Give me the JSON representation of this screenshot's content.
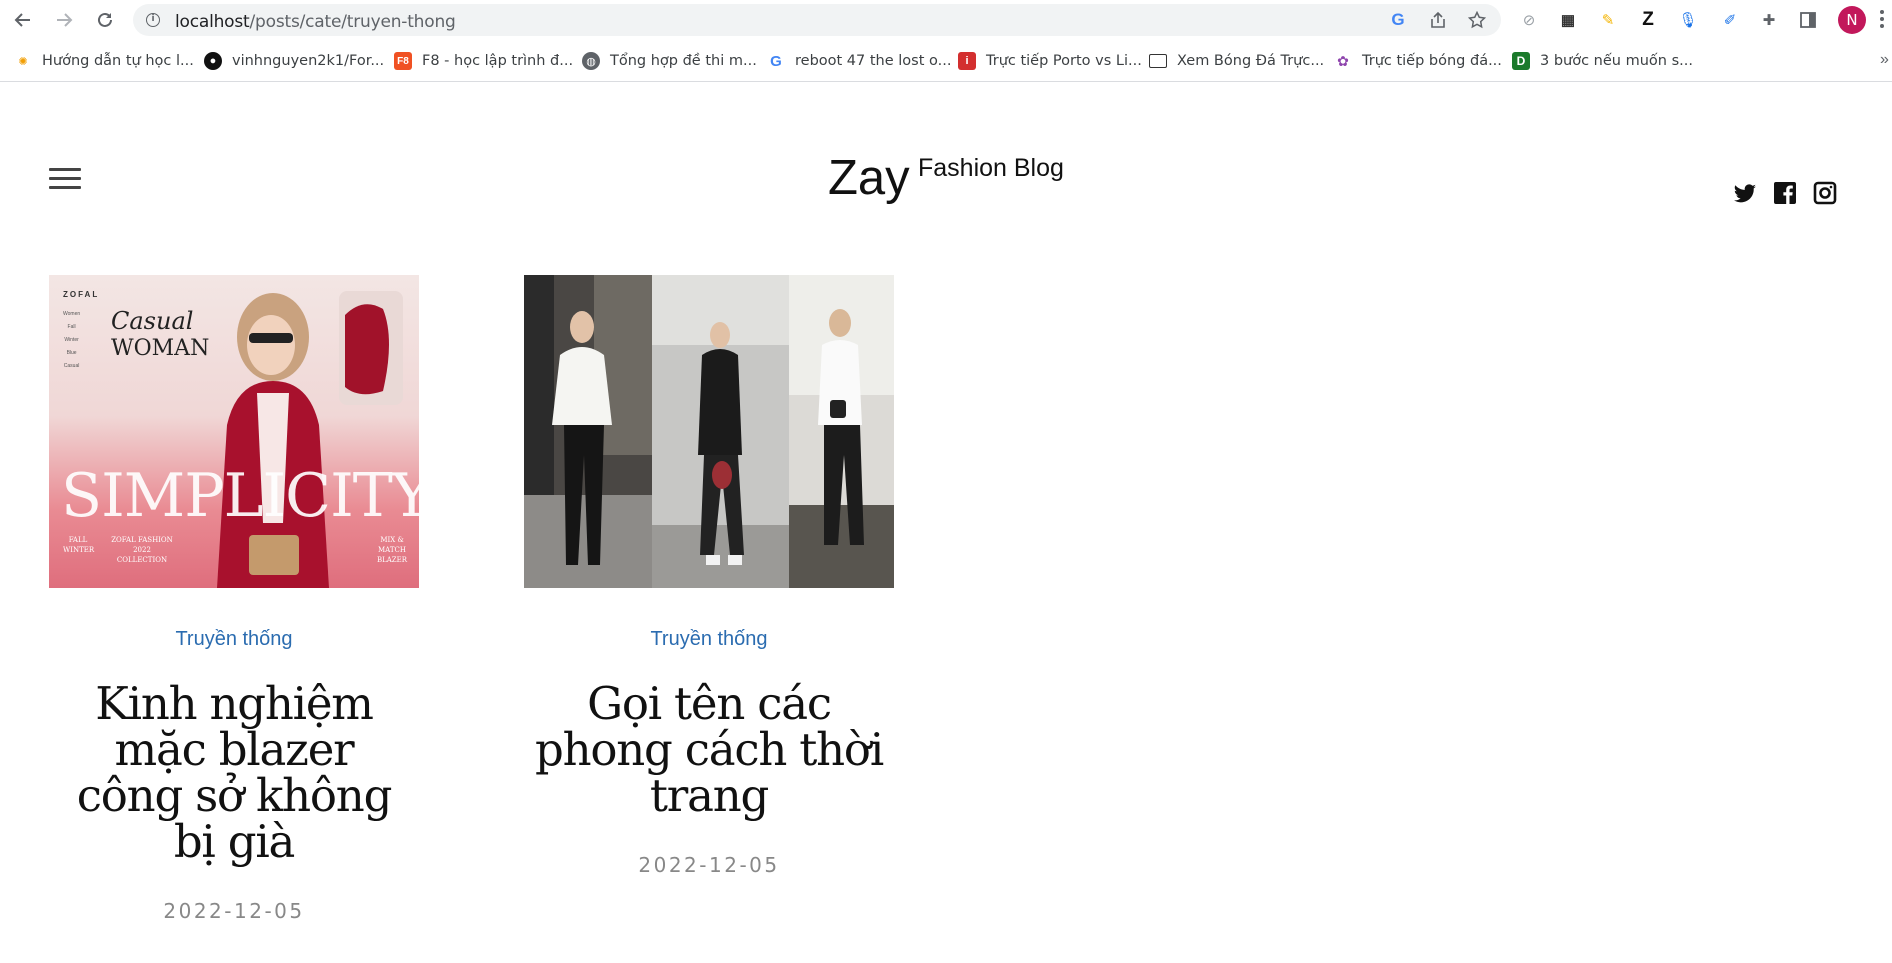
{
  "browser": {
    "url_host": "localhost",
    "url_path": "/posts/cate/truyen-thong",
    "avatar_initial": "N"
  },
  "bookmarks": [
    {
      "label": "Hướng dẫn tự học l...",
      "icon": "dotted-logo-icon"
    },
    {
      "label": "vinhnguyen2k1/For...",
      "icon": "github-icon"
    },
    {
      "label": "F8 - học lập trình đ...",
      "icon": "f8-icon"
    },
    {
      "label": "Tổng hợp đề thi m...",
      "icon": "globe-icon"
    },
    {
      "label": "reboot 47 the lost o...",
      "icon": "google-icon"
    },
    {
      "label": "Trực tiếp Porto vs Li...",
      "icon": "red-square-icon"
    },
    {
      "label": "Xem Bóng Đá Trực...",
      "icon": "tv-icon"
    },
    {
      "label": "Trực tiếp bóng đá...",
      "icon": "flower-icon"
    },
    {
      "label": "3 bước nếu muốn s...",
      "icon": "d-green-icon"
    }
  ],
  "site": {
    "brand": "Zay",
    "tagline": "Fashion Blog"
  },
  "posts": [
    {
      "category": "Truyền thống",
      "title": "Kinh nghiệm mặc blazer công sở không bị già",
      "date": "2022-12-05",
      "image_text": {
        "brand": "ZOFAL",
        "menu": [
          "Women",
          "Fall",
          "Winter",
          "Blue",
          "Casual"
        ],
        "headline1": "Casual",
        "headline2": "WOMAN",
        "big": "SIMPLICITY",
        "footer": [
          "FALL WINTER",
          "ZOFAL FASHION 2022 COLLECTION",
          "MIX & MATCH BLAZER"
        ]
      }
    },
    {
      "category": "Truyền thống",
      "title": "Gọi tên các phong cách thời trang",
      "date": "2022-12-05"
    }
  ],
  "colors": {
    "category_link": "#2b6cb0",
    "date": "#888888",
    "avatar": "#c2185b"
  }
}
